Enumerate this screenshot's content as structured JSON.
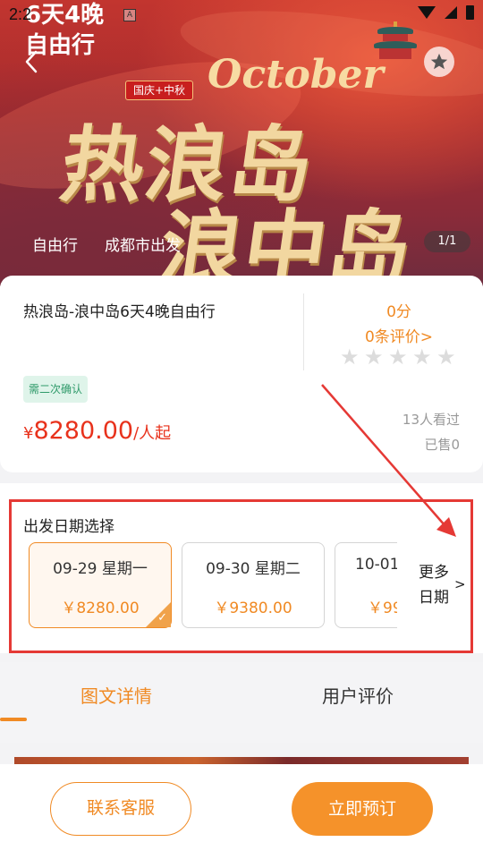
{
  "status_bar": {
    "time": "2:2",
    "a_icon": "A"
  },
  "hero": {
    "title_line1": "6天4晚",
    "title_line2": "自由行",
    "badge": "国庆+中秋",
    "october": "October",
    "big_line1": "热浪岛",
    "big_line2": "浪中岛",
    "tags": [
      "自由行",
      "成都市出发"
    ],
    "pager": "1/1"
  },
  "product": {
    "title": "热浪岛-浪中岛6天4晚自由行",
    "score": "0分",
    "reviews_link": "0条评价>",
    "confirm_tag": "需二次确认",
    "price_currency": "¥",
    "price_amount": "8280.00",
    "price_unit": "/人起",
    "viewers": "13人看过",
    "sold": "已售0"
  },
  "dates": {
    "title": "出发日期选择",
    "items": [
      {
        "date": "09-29 星期一",
        "price": "￥8280.00",
        "selected": true
      },
      {
        "date": "09-30 星期二",
        "price": "￥9380.00",
        "selected": false
      },
      {
        "date": "10-01",
        "price": "￥99",
        "selected": false
      }
    ],
    "more_line1": "更多",
    "more_line2": "日期",
    "more_arrow": ">"
  },
  "tabs": {
    "detail": "图文详情",
    "reviews": "用户评价"
  },
  "bottom": {
    "contact": "联系客服",
    "book": "立即预订"
  },
  "colors": {
    "accent": "#f08a24",
    "price": "#e8321c",
    "annotation": "#e53935"
  }
}
